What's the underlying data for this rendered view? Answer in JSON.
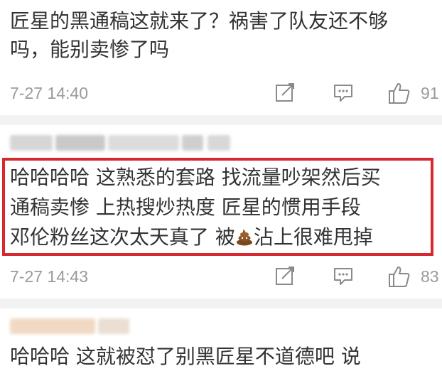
{
  "comments": [
    {
      "lines": [
        "匠星的黑通稿这就来了？祸害了队友还不够",
        "吗，能别卖惨了吗"
      ],
      "timestamp": "7-27 14:40",
      "likes": "91"
    },
    {
      "lines": [
        "哈哈哈哈 这熟悉的套路 找流量吵架然后买",
        "通稿卖惨 上热搜炒热度   匠星的惯用手段"
      ],
      "line3_before": "邓伦粉丝这次太天真了 被",
      "line3_after": "沾上很难甩掉",
      "timestamp": "7-27 14:43",
      "likes": "83"
    },
    {
      "partial_line": "哈哈哈 这就被怼了别黑匠星不道德吧 说"
    }
  ],
  "icons": {
    "share": "share-edit-icon",
    "comment": "comment-bubble-icon",
    "like": "thumbs-up-icon",
    "emoji": "poop-emoji-icon"
  },
  "colors": {
    "text": "#333333",
    "meta": "#9a9a9a",
    "highlight": "#d8282f",
    "divider": "#f2f2f2"
  }
}
